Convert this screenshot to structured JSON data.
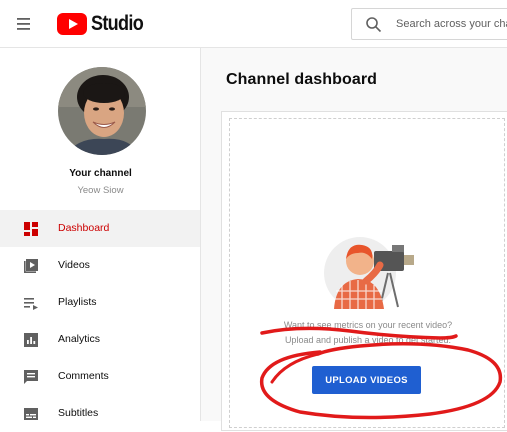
{
  "header": {
    "logo_text": "Studio",
    "search_placeholder": "Search across your char"
  },
  "sidebar": {
    "channel_title": "Your channel",
    "channel_name": "Yeow Siow",
    "items": [
      {
        "label": "Dashboard",
        "icon": "dashboard-icon",
        "active": true
      },
      {
        "label": "Videos",
        "icon": "videos-icon"
      },
      {
        "label": "Playlists",
        "icon": "playlists-icon"
      },
      {
        "label": "Analytics",
        "icon": "analytics-icon"
      },
      {
        "label": "Comments",
        "icon": "comments-icon"
      },
      {
        "label": "Subtitles",
        "icon": "subtitles-icon"
      }
    ]
  },
  "main": {
    "title": "Channel dashboard",
    "card": {
      "prompt_line1": "Want to see metrics on your recent video?",
      "prompt_line2": "Upload and publish a video to get started.",
      "upload_label": "UPLOAD VIDEOS"
    }
  },
  "colors": {
    "brand_red": "#ff0000",
    "active_text": "#cc0000",
    "primary_button": "#1f5fd1",
    "annotation_red": "#e11a1a"
  }
}
